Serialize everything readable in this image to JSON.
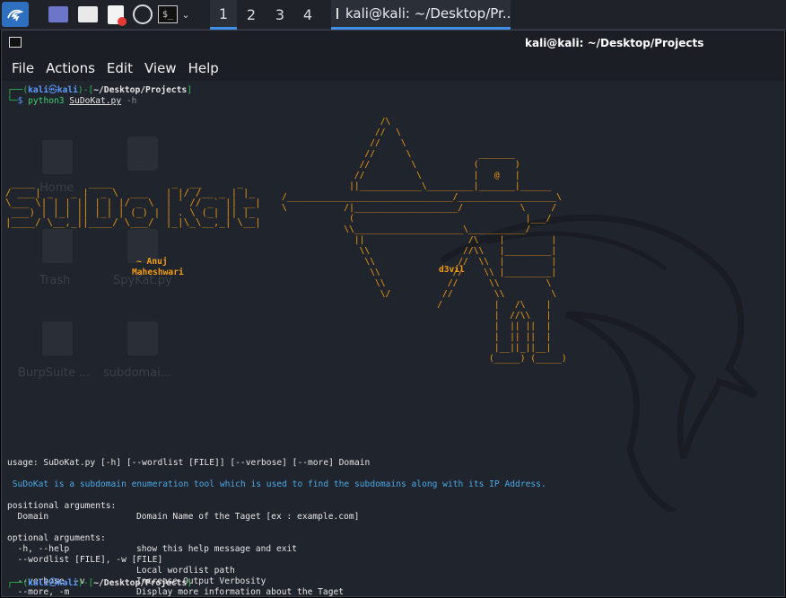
{
  "taskbar": {
    "workspaces": [
      "1",
      "2",
      "3",
      "4"
    ],
    "active_workspace": "1",
    "task_title": "kali@kali: ~/Desktop/Pr..."
  },
  "window": {
    "title": "kali@kali: ~/Desktop/Projects",
    "menu": [
      "File",
      "Actions",
      "Edit",
      "View",
      "Help"
    ]
  },
  "terminal": {
    "prompt_user": "kali",
    "prompt_at": "㉿",
    "prompt_host": "kali",
    "prompt_path": "~/Desktop/Projects",
    "command": "python3",
    "command_file": "SuDoKat.py",
    "command_flag": "-h",
    "author_line1": "~ Anuj",
    "author_line2": "Maheshwari",
    "d3vil": "d3vil",
    "usage": "usage: SuDoKat.py [-h] [--wordlist [FILE]] [--verbose] [--more] Domain",
    "description": " SuDoKat is a subdomain enumeration tool which is used to find the subdomains along with its IP Address.",
    "positional_header": "positional arguments:",
    "positional": [
      {
        "name": "  Domain",
        "help": "Domain Name of the Taget [ex : example.com]"
      }
    ],
    "optional_header": "optional arguments:",
    "optional": [
      {
        "name": "  -h, --help",
        "help": "show this help message and exit"
      },
      {
        "name": "  --wordlist [FILE], -w [FILE]",
        "help": ""
      },
      {
        "name": "",
        "help": "Local wordlist path"
      },
      {
        "name": "  --verbose, -v",
        "help": "Increase Output Verbosity"
      },
      {
        "name": "  --more, -m",
        "help": "Display more information about the Taget"
      }
    ],
    "ghost_icons": [
      "Home",
      "Trash",
      "SpyKat.py",
      "BurpSuite ...",
      "subdomai..."
    ]
  },
  "colors": {
    "accent": "#3f8fe8",
    "terminal_bg": "#20242c",
    "art": "#f39c12"
  }
}
